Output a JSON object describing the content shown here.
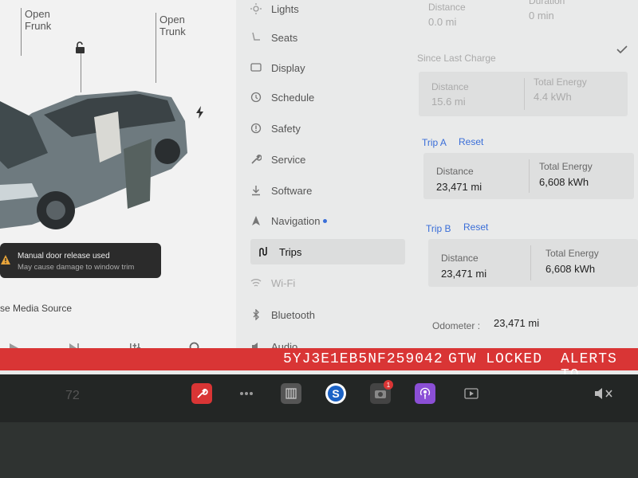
{
  "left_panel": {
    "open_frunk": "Open\nFrunk",
    "open_trunk": "Open\nTrunk",
    "toast_title": "Manual door release used",
    "toast_sub": "May cause damage to window trim",
    "media_source": "se Media Source"
  },
  "menu": {
    "items": [
      {
        "label": "Lights",
        "icon": "lightbulb-icon"
      },
      {
        "label": "Seats",
        "icon": "seat-icon"
      },
      {
        "label": "Display",
        "icon": "display-icon"
      },
      {
        "label": "Schedule",
        "icon": "clock-icon"
      },
      {
        "label": "Safety",
        "icon": "info-icon"
      },
      {
        "label": "Service",
        "icon": "wrench-icon"
      },
      {
        "label": "Software",
        "icon": "download-icon"
      },
      {
        "label": "Navigation",
        "icon": "navigation-icon"
      },
      {
        "label": "Trips",
        "icon": "trips-icon"
      },
      {
        "label": "Wi-Fi",
        "icon": "wifi-icon"
      },
      {
        "label": "Bluetooth",
        "icon": "bluetooth-icon"
      },
      {
        "label": "Audio",
        "icon": "audio-icon"
      }
    ]
  },
  "trips": {
    "top_distance_label": "Distance",
    "top_distance_value": "0.0 mi",
    "top_duration_label": "Duration",
    "top_duration_value": "0 min",
    "since_last_charge": "Since Last Charge",
    "slc_distance_label": "Distance",
    "slc_distance_value": "15.6 mi",
    "slc_energy_label": "Total Energy",
    "slc_energy_value": "4.4 kWh",
    "trip_a": "Trip A",
    "trip_a_reset": "Reset",
    "a_distance_label": "Distance",
    "a_distance_value": "23,471 mi",
    "a_energy_label": "Total Energy",
    "a_energy_value": "6,608 kWh",
    "trip_b": "Trip B",
    "trip_b_reset": "Reset",
    "b_distance_label": "Distance",
    "b_distance_value": "23,471 mi",
    "b_energy_label": "Total Energy",
    "b_energy_value": "6,608 kWh",
    "odometer_label": "Odometer :",
    "odometer_value": "23,471 mi"
  },
  "banner": {
    "vin": "5YJ3E1EB5NF259042",
    "gtw": "GTW LOCKED",
    "alerts": "ALERTS TO"
  },
  "dock": {
    "temp": "72",
    "notification_count": "1"
  },
  "colors": {
    "accent_blue": "#3a6ed8",
    "banner_red": "#d93535",
    "toast_bg": "#2b2b2b"
  }
}
